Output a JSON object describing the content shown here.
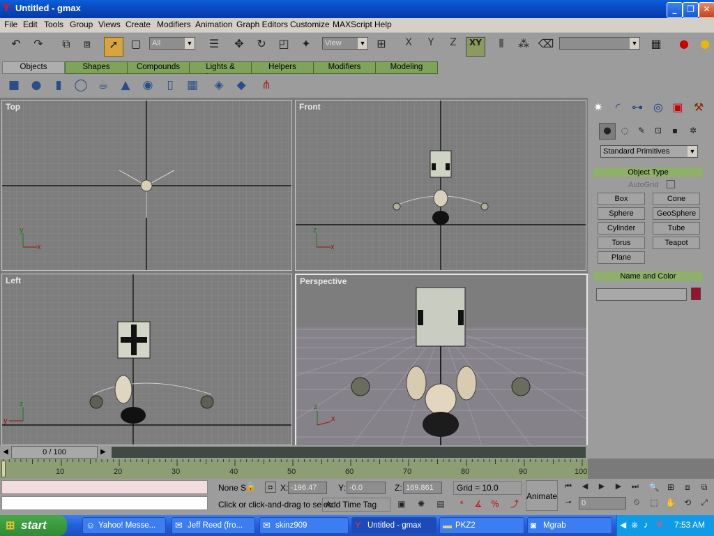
{
  "window": {
    "title": "Untitled - gmax",
    "min": "_",
    "max": "❐",
    "close": "✕"
  },
  "menu": [
    "File",
    "Edit",
    "Tools",
    "Group",
    "Views",
    "Create",
    "Modifiers",
    "Animation",
    "Graph Editors",
    "Customize",
    "MAXScript",
    "Help"
  ],
  "toolbar": {
    "selection_filter": "All",
    "ref_coord": "View",
    "named_selection": "",
    "axis_x": "X",
    "axis_y": "Y",
    "axis_z": "Z",
    "axis_xy": "XY"
  },
  "tabs": [
    "Objects",
    "Shapes",
    "Compounds",
    "Lights & Cameras",
    "Helpers",
    "Modifiers",
    "Modeling"
  ],
  "viewports": {
    "top": "Top",
    "front": "Front",
    "left": "Left",
    "perspective": "Perspective"
  },
  "axis_labels": {
    "x": "x",
    "y": "y",
    "z": "z"
  },
  "command_panel": {
    "category": "Standard Primitives",
    "object_type": {
      "header": "Object Type",
      "autogrid": "AutoGrid",
      "buttons": [
        "Box",
        "Cone",
        "Sphere",
        "GeoSphere",
        "Cylinder",
        "Tube",
        "Torus",
        "Teapot",
        "Plane"
      ]
    },
    "name_color": {
      "header": "Name and Color",
      "name": "",
      "color": "#9a1030"
    },
    "accent": "#8eb06a"
  },
  "timeline": {
    "frame_label": "0 / 100",
    "ticks": [
      "10",
      "20",
      "30",
      "40",
      "50",
      "60",
      "70",
      "80",
      "90",
      "100"
    ]
  },
  "status": {
    "selection": "None S",
    "x_label": "X:",
    "x_value": "-196.47",
    "y_label": "Y:",
    "y_value": "-0.0",
    "z_label": "Z:",
    "z_value": "169.861",
    "grid": "Grid = 10.0",
    "prompt": "Click or click-and-drag to selec",
    "add_time_tag": "Add Time Tag",
    "animate": "Animate",
    "frame": "0"
  },
  "taskbar": {
    "start": "start",
    "tasks": [
      "Yahoo! Messe...",
      "Jeff Reed (fro...",
      "skinz909",
      "Untitled - gmax",
      "PKZ2",
      "Mgrab"
    ],
    "clock": "7:53 AM"
  }
}
